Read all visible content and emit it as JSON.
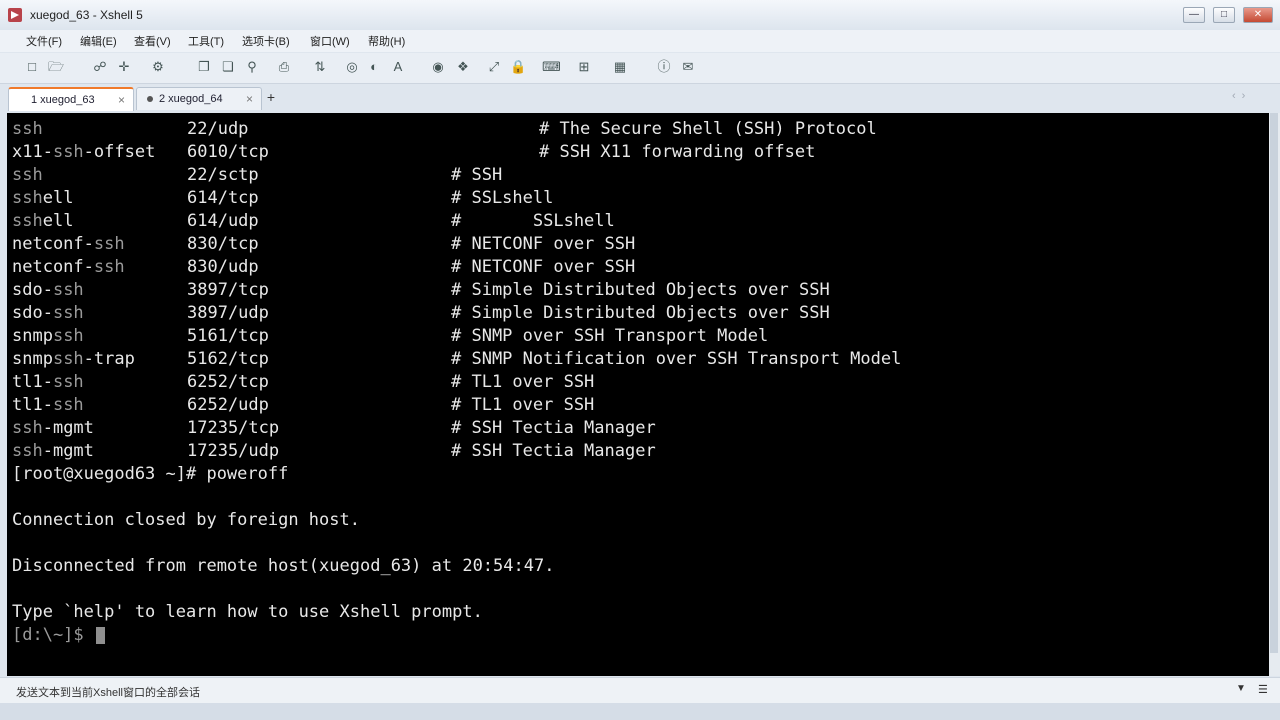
{
  "window": {
    "title": "xuegod_63 - Xshell 5"
  },
  "menu": [
    "文件(F)",
    "编辑(E)",
    "查看(V)",
    "工具(T)",
    "选项卡(B)",
    "窗口(W)",
    "帮助(H)"
  ],
  "tabs": [
    {
      "label": "1 xuegod_63",
      "close": "×"
    },
    {
      "label": "2 xuegod_64",
      "close": "×"
    }
  ],
  "new_tab": "+",
  "services": [
    {
      "name": "ssh",
      "port": "22/udp",
      "comment": "# The Secure Shell (SSH) Protocol",
      "wide": true
    },
    {
      "name": "x11-ssh-offset",
      "port": "6010/tcp",
      "comment": "# SSH X11 forwarding offset",
      "wide": true
    },
    {
      "name": "ssh",
      "port": "22/sctp",
      "comment": "# SSH",
      "wide": false
    },
    {
      "name": "sshell",
      "port": "614/tcp",
      "comment": "# SSLshell",
      "wide": false
    },
    {
      "name": "sshell",
      "port": "614/udp",
      "comment": "#       SSLshell",
      "wide": false
    },
    {
      "name": "netconf-ssh",
      "port": "830/tcp",
      "comment": "# NETCONF over SSH",
      "wide": false
    },
    {
      "name": "netconf-ssh",
      "port": "830/udp",
      "comment": "# NETCONF over SSH",
      "wide": false
    },
    {
      "name": "sdo-ssh",
      "port": "3897/tcp",
      "comment": "# Simple Distributed Objects over SSH",
      "wide": false
    },
    {
      "name": "sdo-ssh",
      "port": "3897/udp",
      "comment": "# Simple Distributed Objects over SSH",
      "wide": false
    },
    {
      "name": "snmpssh",
      "port": "5161/tcp",
      "comment": "# SNMP over SSH Transport Model",
      "wide": false
    },
    {
      "name": "snmpssh-trap",
      "port": "5162/tcp",
      "comment": "# SNMP Notification over SSH Transport Model",
      "wide": false
    },
    {
      "name": "tl1-ssh",
      "port": "6252/tcp",
      "comment": "# TL1 over SSH",
      "wide": false
    },
    {
      "name": "tl1-ssh",
      "port": "6252/udp",
      "comment": "# TL1 over SSH",
      "wide": false
    },
    {
      "name": "ssh-mgmt",
      "port": "17235/tcp",
      "comment": "# SSH Tectia Manager",
      "wide": false
    },
    {
      "name": "ssh-mgmt",
      "port": "17235/udp",
      "comment": "# SSH Tectia Manager",
      "wide": false
    }
  ],
  "after_lines": [
    "[root@xuegod63 ~]# poweroff",
    "",
    "Connection closed by foreign host.",
    "",
    "Disconnected from remote host(xuegod_63) at 20:54:47.",
    "",
    "Type `help' to learn how to use Xshell prompt."
  ],
  "prompt": "[d:\\~]$ ",
  "status": {
    "text": "发送文本到当前Xshell窗口的全部会话"
  },
  "highlight_term": "ssh",
  "colors": {
    "terminal_bg": "#000000",
    "terminal_fg": "#e8e8e8",
    "highlight": "#9a9a9a",
    "active_tab_accent": "#f07a2b"
  }
}
